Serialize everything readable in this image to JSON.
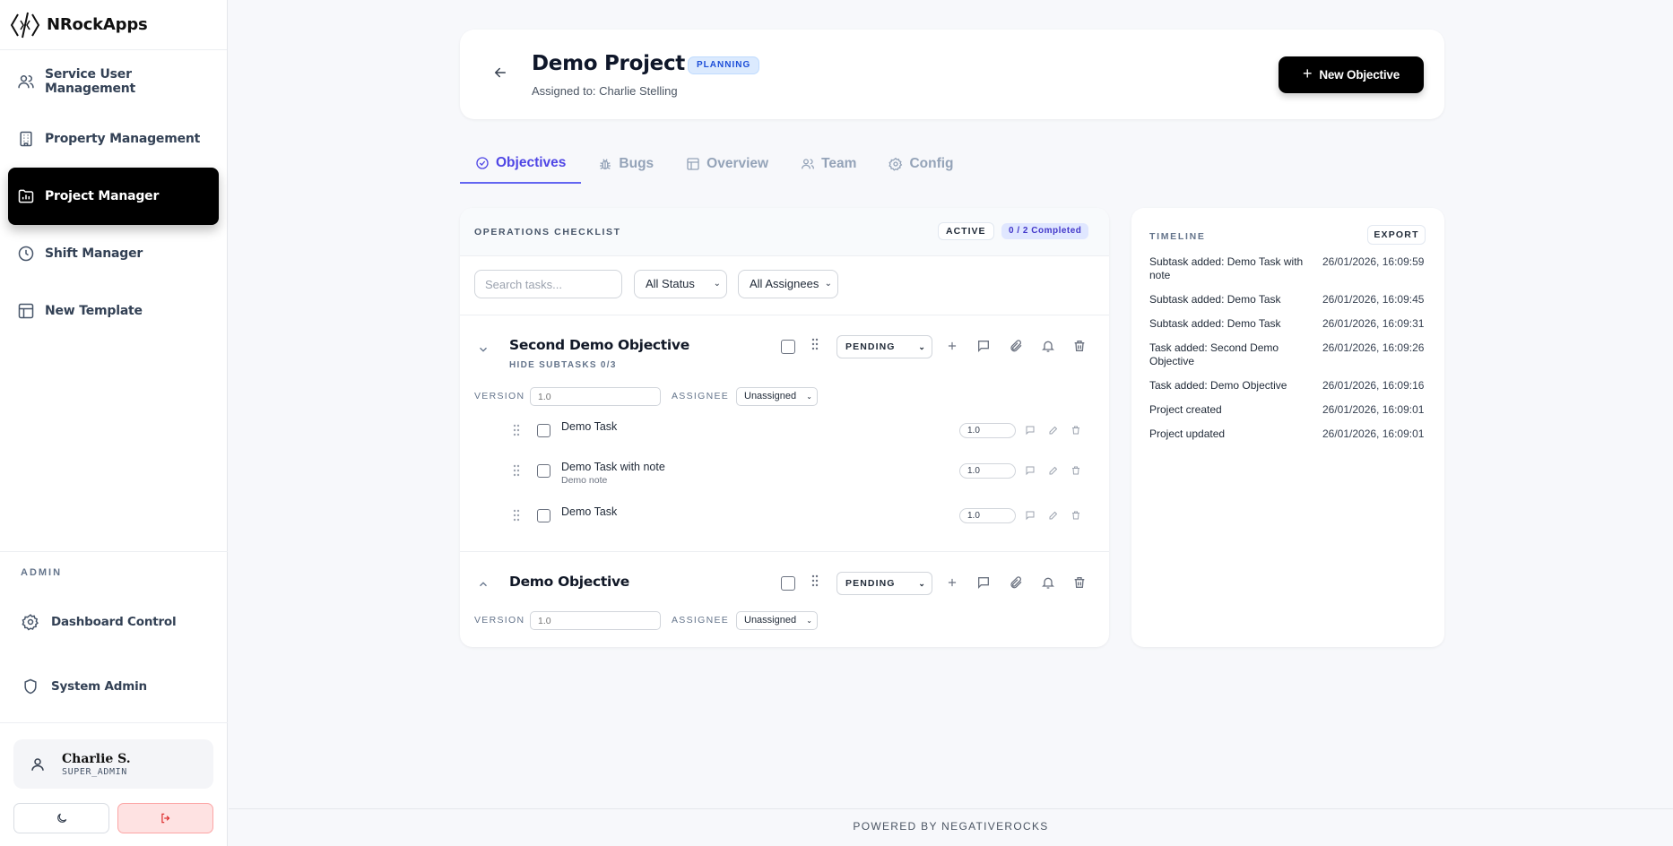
{
  "brand": {
    "name": "NRockApps"
  },
  "sidebar": {
    "items": [
      {
        "label": "Service User Management",
        "icon": "users-icon"
      },
      {
        "label": "Property Management",
        "icon": "building-icon"
      },
      {
        "label": "Project Manager",
        "icon": "folder-chart-icon",
        "active": true
      },
      {
        "label": "Shift Manager",
        "icon": "clock-icon"
      },
      {
        "label": "New Template",
        "icon": "layout-icon"
      }
    ],
    "admin_label": "ADMIN",
    "admin_items": [
      {
        "label": "Dashboard Control",
        "icon": "gear-icon"
      },
      {
        "label": "System Admin",
        "icon": "shield-icon"
      }
    ],
    "user": {
      "name": "Charlie S.",
      "role": "SUPER_ADMIN"
    }
  },
  "header": {
    "title": "Demo Project",
    "status": "PLANNING",
    "assigned": "Assigned to: Charlie Stelling",
    "new_objective_label": "New Objective"
  },
  "tabs": [
    {
      "label": "Objectives",
      "icon": "check-circle-icon",
      "active": true
    },
    {
      "label": "Bugs",
      "icon": "bug-icon"
    },
    {
      "label": "Overview",
      "icon": "layout-icon"
    },
    {
      "label": "Team",
      "icon": "users-icon"
    },
    {
      "label": "Config",
      "icon": "gear-icon"
    }
  ],
  "checklist": {
    "title": "OPERATIONS CHECKLIST",
    "state": "ACTIVE",
    "completed": "0 / 2 Completed",
    "search_placeholder": "Search tasks...",
    "status_filter": "All Status",
    "assignee_filter": "All Assignees",
    "version_label": "VERSION",
    "assignee_label": "ASSIGNEE",
    "objectives": [
      {
        "name": "Second Demo Objective",
        "subtasks_toggle": "HIDE SUBTASKS 0/3",
        "status": "PENDING",
        "version_placeholder": "1.0",
        "assignee": "Unassigned",
        "tasks": [
          {
            "name": "Demo Task",
            "note": "",
            "version": "1.0"
          },
          {
            "name": "Demo Task with note",
            "note": "Demo note",
            "version": "1.0"
          },
          {
            "name": "Demo Task",
            "note": "",
            "version": "1.0"
          }
        ]
      },
      {
        "name": "Demo Objective",
        "status": "PENDING",
        "version_placeholder": "1.0",
        "assignee": "Unassigned"
      }
    ]
  },
  "timeline": {
    "title": "TIMELINE",
    "export_label": "EXPORT",
    "events": [
      {
        "text": "Subtask added: Demo Task with note",
        "time": "26/01/2026, 16:09:59"
      },
      {
        "text": "Subtask added: Demo Task",
        "time": "26/01/2026, 16:09:45"
      },
      {
        "text": "Subtask added: Demo Task",
        "time": "26/01/2026, 16:09:31"
      },
      {
        "text": "Task added: Second Demo Objective",
        "time": "26/01/2026, 16:09:26"
      },
      {
        "text": "Task added: Demo Objective",
        "time": "26/01/2026, 16:09:16"
      },
      {
        "text": "Project created",
        "time": "26/01/2026, 16:09:01"
      },
      {
        "text": "Project updated",
        "time": "26/01/2026, 16:09:01"
      }
    ]
  },
  "footer": {
    "text": "POWERED BY NEGATIVEROCKS"
  },
  "colors": {
    "accent": "#4f46e5",
    "planning_bg": "#dbeafe",
    "logout_bg": "#fee2e2"
  }
}
